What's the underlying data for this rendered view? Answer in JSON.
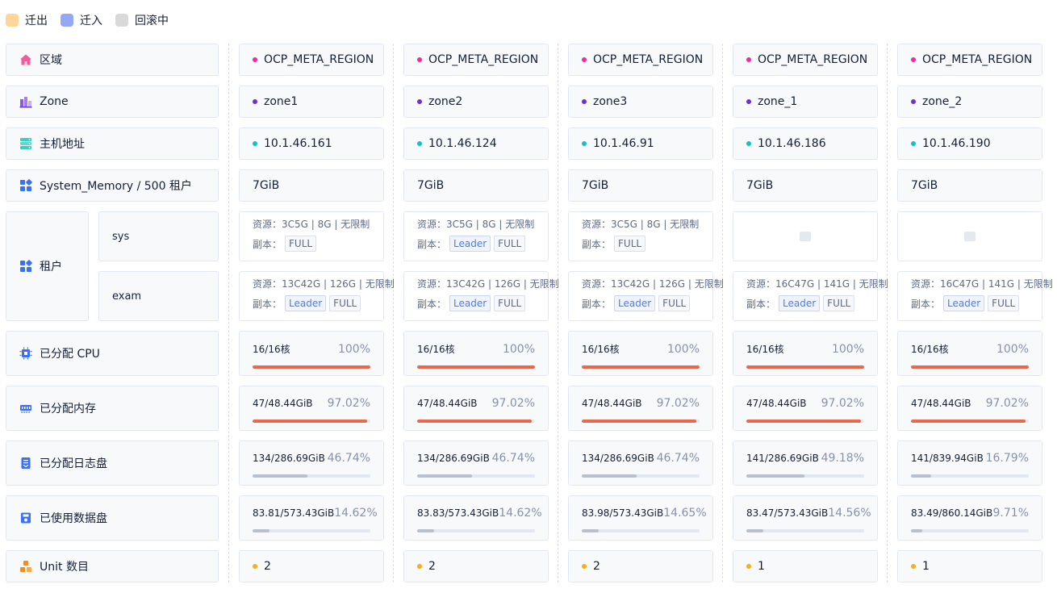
{
  "legend": [
    {
      "label": "迁出",
      "color": "#ffd699"
    },
    {
      "label": "迁入",
      "color": "#94a8f5"
    },
    {
      "label": "回滚中",
      "color": "#d9d9d9"
    }
  ],
  "row_labels": {
    "region": "区域",
    "zone": "Zone",
    "host": "主机地址",
    "memory": "System_Memory / 500 租户",
    "tenant": "租户",
    "cpu": "已分配 CPU",
    "mem_alloc": "已分配内存",
    "log_disk": "已分配日志盘",
    "data_disk": "已使用数据盘",
    "unit": "Unit 数目"
  },
  "tenants": [
    "sys",
    "exam"
  ],
  "labels": {
    "resource_prefix": "资源：",
    "replica_prefix": "副本："
  },
  "colors": {
    "region_dot": "#eb2f96",
    "zone_dot": "#722ed1",
    "host_dot": "#13c2c2",
    "unit_dot": "#faad14",
    "bar_high": "#e8684a",
    "bar_normal": "#b7c0d0"
  },
  "columns": [
    {
      "region": "OCP_META_REGION",
      "zone": "zone1",
      "host": "10.1.46.161",
      "memory": "7GiB",
      "sys": {
        "resource": "3C5G | 8G | 无限制",
        "replicas": [
          "FULL"
        ]
      },
      "exam": {
        "resource": "13C42G | 126G | 无限制",
        "replicas": [
          "Leader",
          "FULL"
        ]
      },
      "cpu": {
        "value": "16/16核",
        "pct": "100%",
        "fill": 1.0
      },
      "mem": {
        "value": "47/48.44GiB",
        "pct": "97.02%",
        "fill": 0.9702
      },
      "log": {
        "value": "134/286.69GiB",
        "pct": "46.74%",
        "fill": 0.4674
      },
      "data": {
        "value": "83.81/573.43GiB",
        "pct": "14.62%",
        "fill": 0.1462
      },
      "units": "2"
    },
    {
      "region": "OCP_META_REGION",
      "zone": "zone2",
      "host": "10.1.46.124",
      "memory": "7GiB",
      "sys": {
        "resource": "3C5G | 8G | 无限制",
        "replicas": [
          "Leader",
          "FULL"
        ]
      },
      "exam": {
        "resource": "13C42G | 126G | 无限制",
        "replicas": [
          "Leader",
          "FULL"
        ]
      },
      "cpu": {
        "value": "16/16核",
        "pct": "100%",
        "fill": 1.0
      },
      "mem": {
        "value": "47/48.44GiB",
        "pct": "97.02%",
        "fill": 0.9702
      },
      "log": {
        "value": "134/286.69GiB",
        "pct": "46.74%",
        "fill": 0.4674
      },
      "data": {
        "value": "83.83/573.43GiB",
        "pct": "14.62%",
        "fill": 0.1462
      },
      "units": "2"
    },
    {
      "region": "OCP_META_REGION",
      "zone": "zone3",
      "host": "10.1.46.91",
      "memory": "7GiB",
      "sys": {
        "resource": "3C5G | 8G | 无限制",
        "replicas": [
          "FULL"
        ]
      },
      "exam": {
        "resource": "13C42G | 126G | 无限制",
        "replicas": [
          "Leader",
          "FULL"
        ]
      },
      "cpu": {
        "value": "16/16核",
        "pct": "100%",
        "fill": 1.0
      },
      "mem": {
        "value": "47/48.44GiB",
        "pct": "97.02%",
        "fill": 0.9702
      },
      "log": {
        "value": "134/286.69GiB",
        "pct": "46.74%",
        "fill": 0.4674
      },
      "data": {
        "value": "83.98/573.43GiB",
        "pct": "14.65%",
        "fill": 0.1465
      },
      "units": "2"
    },
    {
      "region": "OCP_META_REGION",
      "zone": "zone_1",
      "host": "10.1.46.186",
      "memory": "7GiB",
      "sys": null,
      "exam": {
        "resource": "16C47G | 141G | 无限制",
        "replicas": [
          "Leader",
          "FULL"
        ]
      },
      "cpu": {
        "value": "16/16核",
        "pct": "100%",
        "fill": 1.0
      },
      "mem": {
        "value": "47/48.44GiB",
        "pct": "97.02%",
        "fill": 0.9702
      },
      "log": {
        "value": "141/286.69GiB",
        "pct": "49.18%",
        "fill": 0.4918
      },
      "data": {
        "value": "83.47/573.43GiB",
        "pct": "14.56%",
        "fill": 0.1456
      },
      "units": "1"
    },
    {
      "region": "OCP_META_REGION",
      "zone": "zone_2",
      "host": "10.1.46.190",
      "memory": "7GiB",
      "sys": null,
      "exam": {
        "resource": "16C47G | 141G | 无限制",
        "replicas": [
          "Leader",
          "FULL"
        ]
      },
      "cpu": {
        "value": "16/16核",
        "pct": "100%",
        "fill": 1.0
      },
      "mem": {
        "value": "47/48.44GiB",
        "pct": "97.02%",
        "fill": 0.9702
      },
      "log": {
        "value": "141/839.94GiB",
        "pct": "16.79%",
        "fill": 0.1679
      },
      "data": {
        "value": "83.49/860.14GiB",
        "pct": "9.71%",
        "fill": 0.0971
      },
      "units": "1"
    }
  ]
}
